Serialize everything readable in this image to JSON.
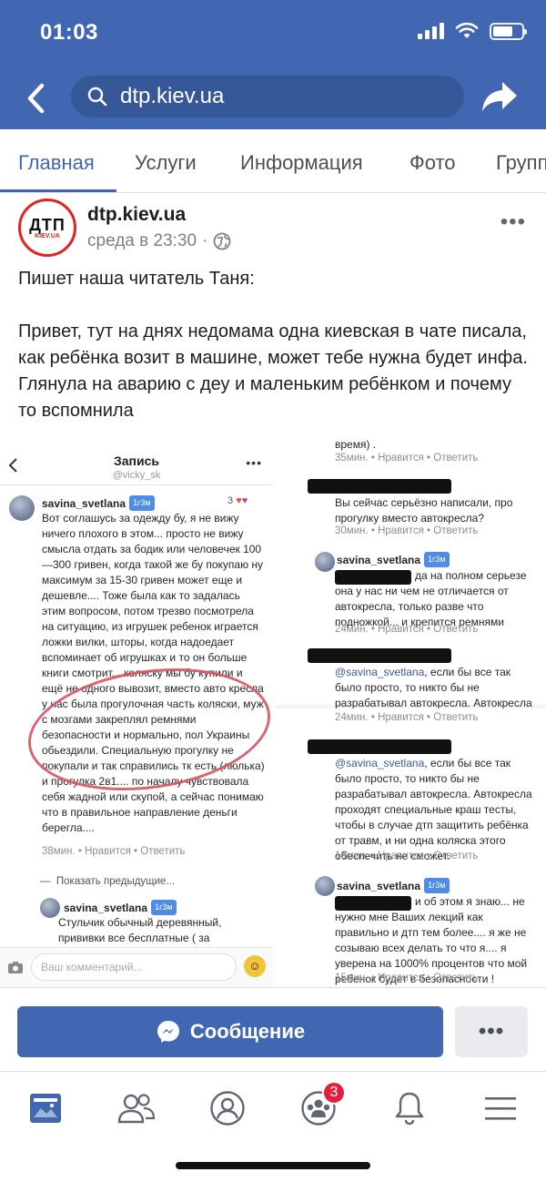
{
  "status_bar": {
    "time": "01:03"
  },
  "browser": {
    "url": "dtp.kiev.ua"
  },
  "tabs": [
    {
      "label": "Главная"
    },
    {
      "label": "Услуги"
    },
    {
      "label": "Информация"
    },
    {
      "label": "Фото"
    },
    {
      "label": "Групп"
    }
  ],
  "post": {
    "avatar_text": "ДТП",
    "avatar_sub": "KIEV.UA",
    "page_name": "dtp.kiev.ua",
    "time": "среда в 23:30",
    "meta_sep": "·",
    "more": "•••",
    "paragraph1": "Пишет наша читатель Таня:",
    "paragraph2": "Привет, тут на днях недомама одна киевская в чате писала, как ребёнка возит в машине, может тебе нужна будет инфа. Глянула на аварию с деу и маленьким ребёнком и почему то вспомнила"
  },
  "screenshot_left": {
    "title": "Запись",
    "subtitle": "@vicky_sk",
    "comment_user": "savina_svetlana",
    "badge": "1г3м",
    "likes": "3",
    "comment_text": "Вот соглашусь за одежду бу, я не вижу ничего плохого в этом... просто не вижу смысла отдать за бодик или человечек 100—300 гривен, когда такой же бу покупаю ну максимум за 15-30 гривен может еще и дешевле.... Тоже была как то задалась этим вопросом, потом трезво посмотрела на ситуацию, из игрушек ребенок играется ложки вилки, шторы, когда надоедает вспоминает об игрушках и то он больше книги смотрит... коляску мы бу купили и ещё не одного вывозит, вместо авто кресла у нас была прогулочная часть коляски, муж с мозгами закреплял ремнями безопасности и нормально, пол Украины обьездили. Специальную прогулку не покупали и так справились тк есть (люлька) и прогулка 2в1.... по началу чувствовала себя жадной или скупой, а сейчас понимаю что в правильное направление деньги берегла....",
    "comment_meta": "38мин. • Нравится • Ответить",
    "show_previous": "Показать предыдущие...",
    "reply_user": "savina_svetlana",
    "reply_badge": "1г3м",
    "reply_text": "Стульчик обычный деревянный, прививки все бесплатные ( за",
    "input_placeholder": "Ваш комментарий..."
  },
  "screenshot_right": {
    "top_text": "время) .",
    "top_meta": "35мин. • Нравится • Ответить",
    "c1_text": "Вы сейчас серьёзно написали, про прогулку вместо автокресла?",
    "c1_meta": "30мин. • Нравится • Ответить",
    "c2_user": "savina_svetlana",
    "c2_badge": "1г3м",
    "c2_text": "да на полном серьезе она у нас ни чем не отличается от автокресла, только разве что подножкой... и крепится ремнями",
    "c2_meta": "24мин. • Нравится • Ответить",
    "c3_mention": "@savina_svetlana",
    "c3_text": ", если бы все так было просто, то никто бы не разрабатывал автокресла. Автокресла проходят",
    "c3_meta": "24мин. • Нравится • Ответить",
    "c4_mention": "@savina_svetlana",
    "c4_text": ", если бы все так было просто, то никто бы не разрабатывал автокресла. Автокресла проходят специальные краш тесты, чтобы в случае дтп защитить ребёнка от травм, и ни одна коляска этого обеспечить не сможет.",
    "c4_meta": "19мин. • Нравится • Ответить",
    "c5_user": "savina_svetlana",
    "c5_badge": "1г3м",
    "c5_text": "и об этом я знаю... не нужно мне Ваших лекций как правильно и дтп тем более.... я же не созываю всех делать то что я.... я уверена на 1000% процентов что мой ребенок будет в безопасности !",
    "c5_meta": "15мин. • Нравится • Ответить"
  },
  "actions": {
    "message_label": "Сообщение",
    "more": "•••"
  },
  "bottom_nav": {
    "notifications_count": "3"
  },
  "colors": {
    "brand": "#4267b2",
    "badge_red": "#e41e3f"
  }
}
